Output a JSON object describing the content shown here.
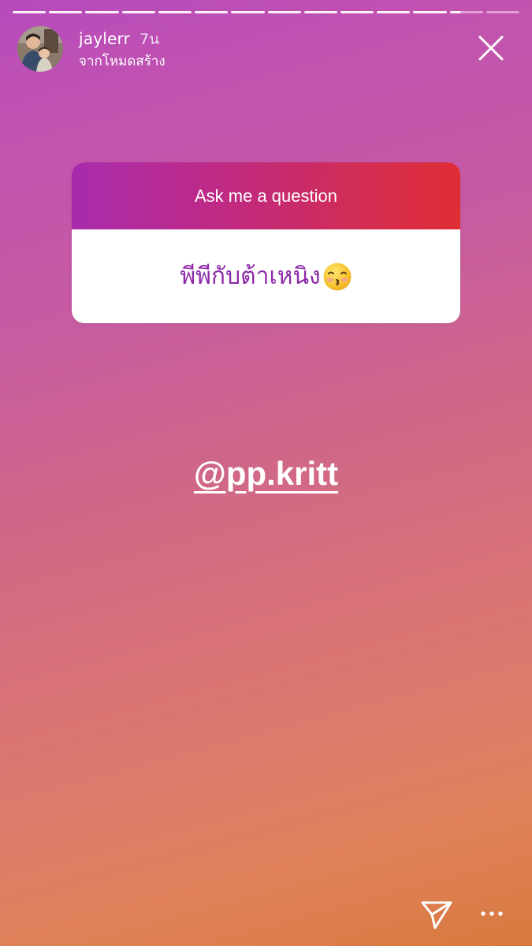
{
  "story": {
    "progress": {
      "segment_count": 14,
      "completed_segments": 12,
      "current_segment_progress": 0.32
    },
    "header": {
      "username": "jaylerr",
      "time_ago": "7น",
      "source_label": "จากโหมดสร้าง"
    },
    "question_sticker": {
      "prompt": "Ask me a question",
      "answer": "พีพีกับต้าเหนิง"
    },
    "mention": {
      "text": "@pp.kritt"
    },
    "icons": {
      "close": "close-icon",
      "send": "send-icon",
      "more": "more-icon",
      "emoji": "kissing-face-emoji"
    },
    "colors": {
      "question_header_start": "#a82bad",
      "question_header_end": "#df2d34",
      "answer_text": "#8d2aa8"
    }
  }
}
